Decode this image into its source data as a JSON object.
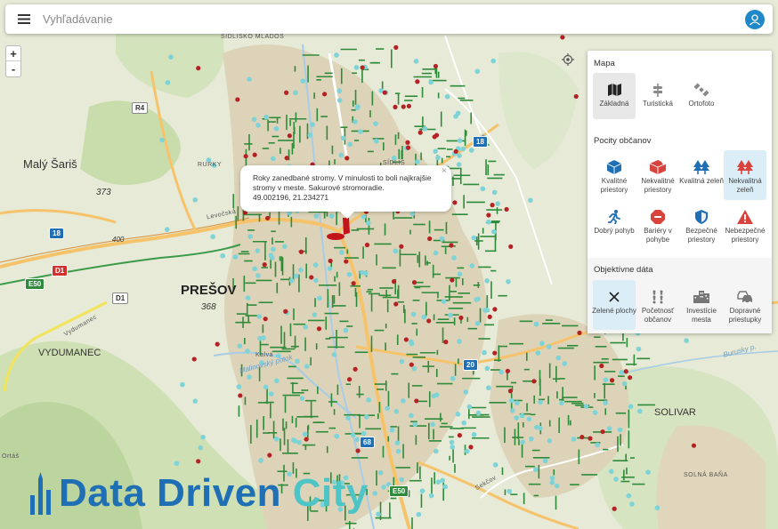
{
  "search": {
    "placeholder": "Vyhľadávanie"
  },
  "zoom": {
    "in": "+",
    "out": "-"
  },
  "popup": {
    "text": "Roky zanedbané stromy. V minulosti to boli najkrajšie stromy v meste. Sakurové stromoradie.",
    "coords": "49.002196, 21.234271",
    "close": "×"
  },
  "panel": {
    "map_title": "Mapa",
    "map_layers": [
      {
        "label": "Základná",
        "icon": "map-icon",
        "selected": true
      },
      {
        "label": "Turistická",
        "icon": "signpost-icon",
        "selected": false
      },
      {
        "label": "Ortofoto",
        "icon": "satellite-icon",
        "selected": false
      }
    ],
    "citizens_title": "Pocity občanov",
    "citizens": [
      {
        "label": "Kvalitné priestory",
        "icon": "cube-blue-icon",
        "color": "#1f6fb5"
      },
      {
        "label": "Nekvalitné priestory",
        "icon": "cube-red-icon",
        "color": "#d9433e"
      },
      {
        "label": "Kvalitná zeleň",
        "icon": "trees-blue-icon",
        "color": "#1f6fb5"
      },
      {
        "label": "Nekvalitná zeleň",
        "icon": "trees-red-icon",
        "color": "#d9433e",
        "selected": true
      },
      {
        "label": "Dobrý pohyb",
        "icon": "runner-icon",
        "color": "#1f6fb5"
      },
      {
        "label": "Bariéry v pohybe",
        "icon": "stop-icon",
        "color": "#d9433e"
      },
      {
        "label": "Bezpečné priestory",
        "icon": "shield-icon",
        "color": "#1f6fb5"
      },
      {
        "label": "Nebezpečné priestory",
        "icon": "warning-icon",
        "color": "#d9433e"
      }
    ],
    "objective_title": "Objektívne dáta",
    "objective": [
      {
        "label": "Zelené plochy",
        "icon": "close-x-icon",
        "selected": true
      },
      {
        "label": "Početnosť občanov",
        "icon": "people-grid-icon"
      },
      {
        "label": "Investície mesta",
        "icon": "buildings-icon"
      },
      {
        "label": "Dopravné priestupky",
        "icon": "cars-icon"
      }
    ]
  },
  "places": {
    "presov": "PREŠOV",
    "maly_saris": "Malý Šariš",
    "vydumanec": "VYDUMANEC",
    "solivar": "SOLIVAR",
    "rurky": "RURKY",
    "sidlisko_mladost": "SÍDLISKO MLADOS",
    "sidlisko": "SÍDLIS",
    "solna_bana": "SOLNÁ BAŇA",
    "kalvaria": "Kalvá",
    "vydumanec_road": "Vydumanec",
    "levocska": "Levočská",
    "sekcov": "Sekčov",
    "torysa": "Torysa",
    "orlos": "Ortáš",
    "elev_373": "373",
    "elev_368": "368",
    "elev_400": "400",
    "malinovsky": "Malinovský potok",
    "burusky": "Burusky p."
  },
  "shields": {
    "r4": "R4",
    "e50a": "E50",
    "d1a": "D1",
    "d1b": "D1",
    "r18a": "18",
    "r18b": "18",
    "r20": "20",
    "r68": "68",
    "e50b": "E50"
  },
  "logo": {
    "part1": "Data Driven ",
    "part2": "City"
  },
  "colors": {
    "accent": "#1e88c8",
    "green_area": "#2e8b3a",
    "cyan_dots": "#7fd3d6",
    "red_dots": "#b52224"
  }
}
